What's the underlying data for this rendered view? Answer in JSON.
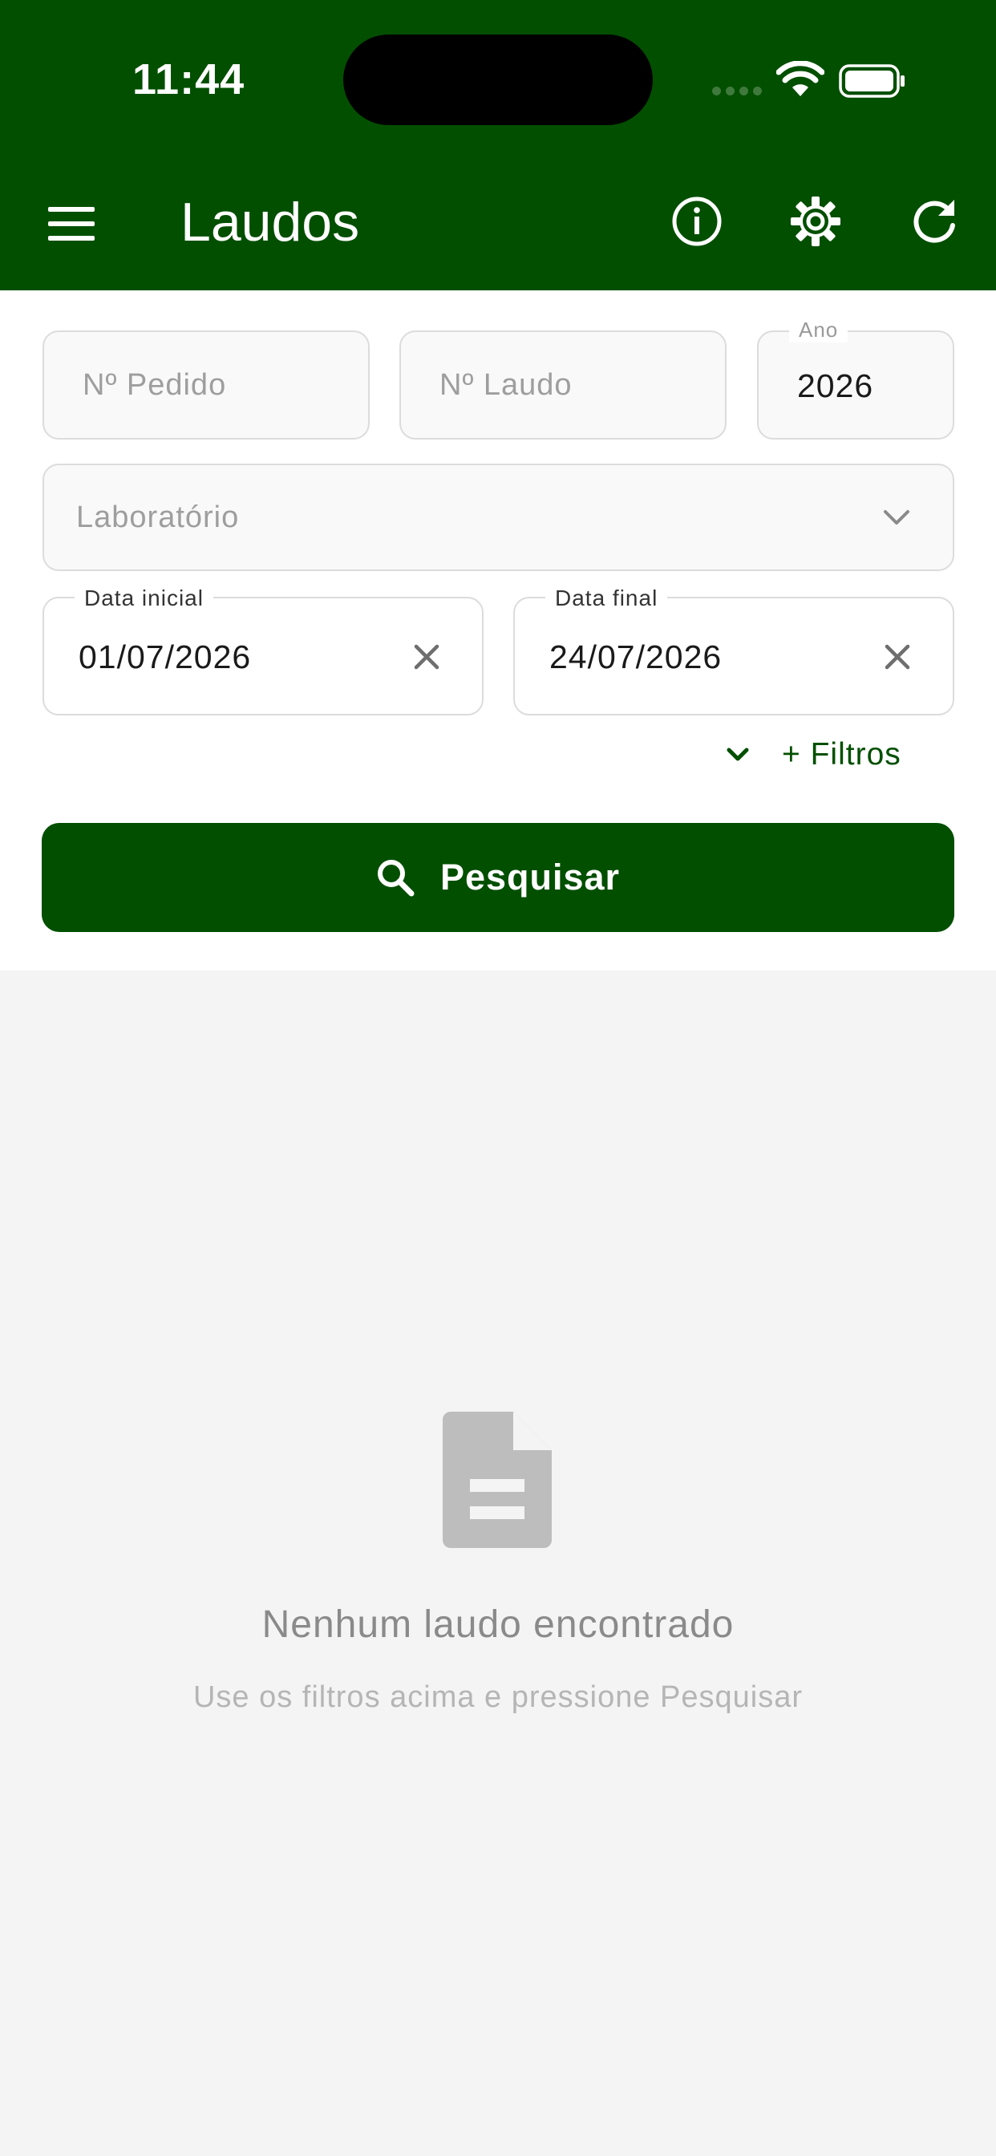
{
  "status_bar": {
    "time": "11:44"
  },
  "header": {
    "title": "Laudos"
  },
  "form": {
    "pedido_placeholder": "Nº Pedido",
    "laudo_placeholder": "Nº Laudo",
    "ano_label": "Ano",
    "ano_value": "2026",
    "laboratorio_placeholder": "Laboratório",
    "data_inicial_label": "Data inicial",
    "data_inicial_value": "01/07/2026",
    "data_final_label": "Data final",
    "data_final_value": "24/07/2026",
    "more_filters_label": "+ Filtros",
    "search_button_label": "Pesquisar"
  },
  "empty_state": {
    "title": "Nenhum laudo encontrado",
    "subtitle": "Use os filtros acima e pressione Pesquisar"
  },
  "colors": {
    "primary": "#024f00",
    "background_empty": "#f4f4f4"
  }
}
